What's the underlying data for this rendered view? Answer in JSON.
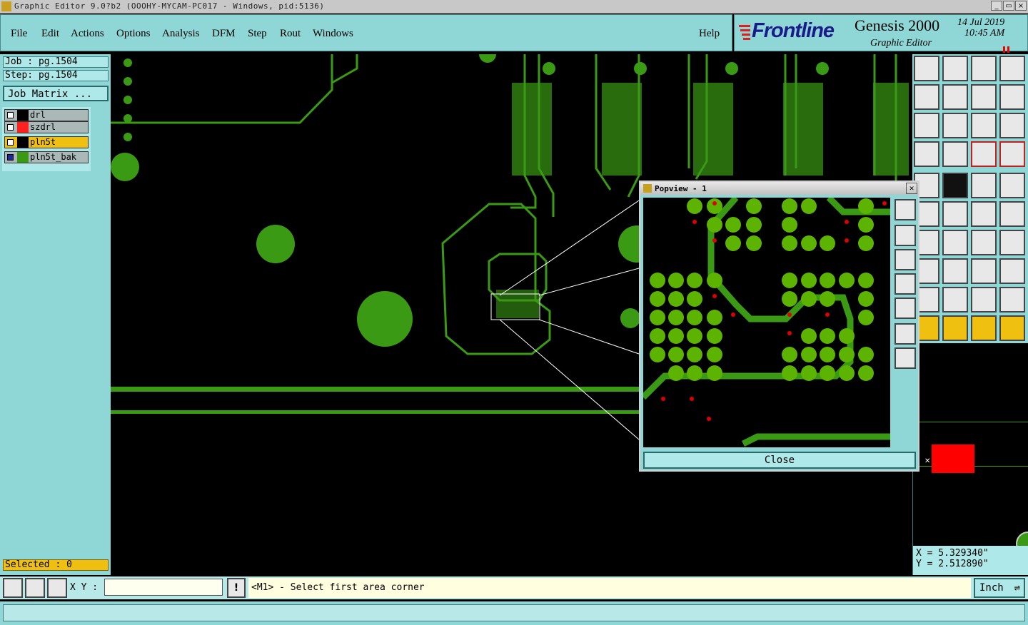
{
  "window": {
    "title": "Graphic Editor 9.0?b2 (OOOHY-MYCAM-PC017 - Windows, pid:5136)",
    "minimize": "_",
    "maximize": "▭",
    "close": "×"
  },
  "menu": {
    "items": [
      "File",
      "Edit",
      "Actions",
      "Options",
      "Analysis",
      "DFM",
      "Step",
      "Rout",
      "Windows"
    ],
    "help": "Help"
  },
  "brand": {
    "logo": "Frontline",
    "product": "Genesis 2000",
    "subtitle": "Graphic Editor",
    "date": "14 Jul 2019",
    "time": "10:45 AM"
  },
  "job": {
    "job_label": "Job : pg.1504",
    "step_label": "Step: pg.1504",
    "matrix_button": "Job Matrix ..."
  },
  "layers": [
    {
      "name": "drl",
      "color": "#000000"
    },
    {
      "name": "szdrl",
      "color": "#ff2020"
    },
    {
      "name": "pln5t",
      "color": "#000000"
    },
    {
      "name": "pln5t_bak",
      "color": "#3a9a14"
    }
  ],
  "selected": "Selected : 0",
  "popview": {
    "title": "Popview - 1",
    "close_button": "Close"
  },
  "coords": {
    "x": "X = 5.329340\"",
    "y": "Y = 2.512890\""
  },
  "status": {
    "xy_label": "X Y :",
    "xy_value": "",
    "prompt": "<M1> - Select first area corner",
    "units": "Inch"
  },
  "colors": {
    "panel": "#8fd6d6",
    "copper": "#3a9a14",
    "pad": "#5cb400",
    "drill": "#e00000"
  }
}
